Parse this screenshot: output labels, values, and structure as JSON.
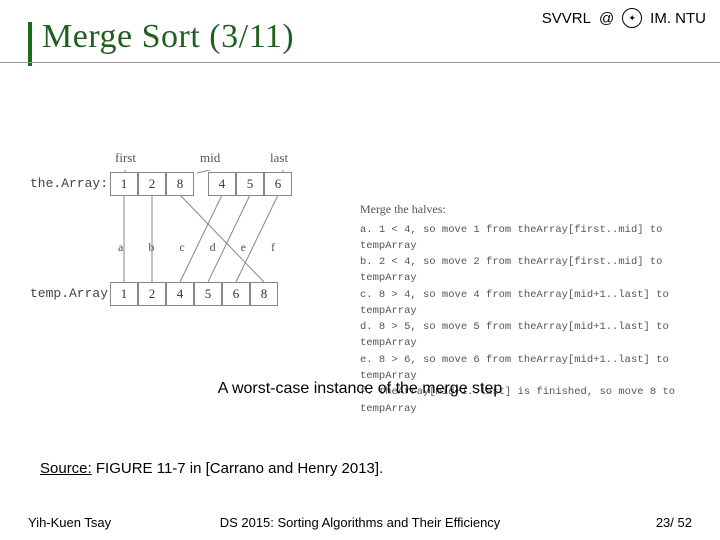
{
  "header": {
    "svvrl": "SVVRL",
    "at": "@",
    "imntu": "IM. NTU"
  },
  "title": "Merge Sort (3/11)",
  "diagram": {
    "labels": {
      "first": "first",
      "mid": "mid",
      "last": "last",
      "theArray": "the.Array:",
      "tempArray": "temp.Array:"
    },
    "topCells": [
      "1",
      "2",
      "8",
      "4",
      "5",
      "6"
    ],
    "bottomCells": [
      "1",
      "2",
      "4",
      "5",
      "6",
      "8"
    ],
    "letters": [
      "a",
      "b",
      "c",
      "d",
      "e",
      "f"
    ],
    "stepsTitle": "Merge the halves:",
    "steps": [
      "a. 1 < 4, so move 1 from theArray[first..mid] to tempArray",
      "b. 2 < 4, so move 2 from theArray[first..mid] to tempArray",
      "c. 8 > 4, so move 4 from theArray[mid+1..last] to tempArray",
      "d. 8 > 5, so move 5 from theArray[mid+1..last] to tempArray",
      "e. 8 > 6, so move 6 from theArray[mid+1..last] to tempArray",
      "f. theArray[mid+1..last] is finished, so move 8 to tempArray"
    ]
  },
  "caption": "A worst-case instance of the merge step",
  "source_label": "Source:",
  "source": "FIGURE 11-7 in [Carrano and Henry 2013].",
  "footer": {
    "author": "Yih-Kuen Tsay",
    "course": "DS 2015: Sorting Algorithms and Their Efficiency",
    "page_cur": "23",
    "page_sep": "/",
    "page_total": "52"
  }
}
